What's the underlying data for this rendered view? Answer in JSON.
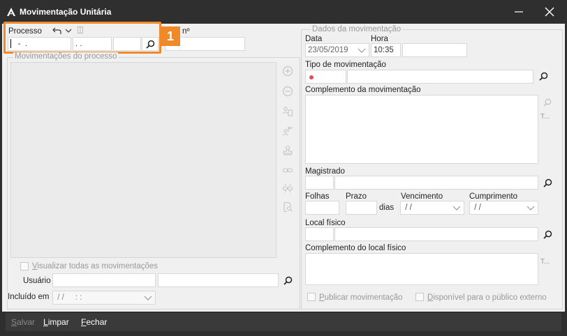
{
  "window": {
    "title": "Movimentação Unitária"
  },
  "processo": {
    "label": "Processo",
    "numero_part1": "  -  .",
    "numero_part2": ". .",
    "numero_part3": "",
    "numero_label": "nº"
  },
  "movimentacoes_processo": {
    "title": "Movimentações do processo"
  },
  "visualizar_todas": {
    "label": "Visualizar todas as movimentações",
    "underline": "V",
    "rest": "isualizar todas as movimentações"
  },
  "usuario": {
    "label": "Usuário"
  },
  "incluido_em": {
    "label": "Incluído em",
    "value": " / /     : :"
  },
  "dados": {
    "title": "Dados da movimentação",
    "data_label": "Data",
    "data_value": "23/05/2019",
    "hora_label": "Hora",
    "hora_value": "10:35",
    "tipo_label": "Tipo de movimentação",
    "complemento_label": "Complemento da movimentação",
    "magistrado_label": "Magistrado",
    "folhas_label": "Folhas",
    "prazo_label": "Prazo",
    "dias_label": "dias",
    "vencimento_label": "Vencimento",
    "vencimento_value": " / /",
    "cumprimento_label": "Cumprimento",
    "cumprimento_value": " / /",
    "local_fisico_label": "Local físico",
    "complemento_local_label": "Complemento do local físico",
    "publicar_u": "P",
    "publicar_rest": "ublicar movimentação",
    "disponivel_u": "D",
    "disponivel_rest": "isponível para o público externo",
    "side_t": "T..."
  },
  "callout": {
    "number": "1"
  },
  "bottom": {
    "salvar_u": "S",
    "salvar_rest": "alvar",
    "limpar_u": "L",
    "limpar_rest": "impar",
    "fechar_u": "F",
    "fechar_rest": "echar"
  },
  "colors": {
    "accent": "#ee8a2a",
    "required": "#e84a5f",
    "bar": "#2f2f2f"
  }
}
